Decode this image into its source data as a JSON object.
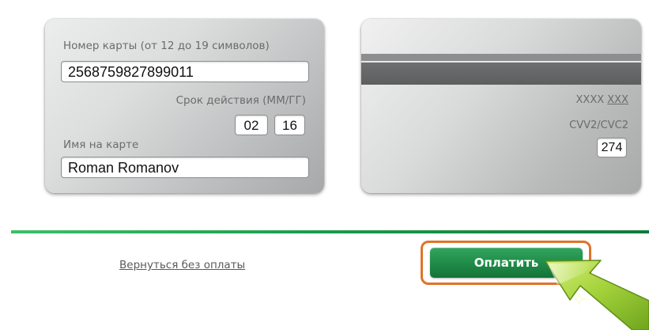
{
  "card_front": {
    "number_label": "Номер карты (от 12 до 19 символов)",
    "number_value": "2568759827899011",
    "expiry_label": "Срок действия (ММ/ГГ)",
    "expiry_month": "02",
    "expiry_year": "16",
    "name_label": "Имя на карте",
    "name_value": "Roman Romanov"
  },
  "card_back": {
    "masked_prefix": "XXXX",
    "masked_suffix": "XXX",
    "cvv_label": "CVV2/CVC2",
    "cvv_value": "274"
  },
  "footer": {
    "back_link": "Вернуться без оплаты",
    "pay_button": "Оплатить"
  },
  "colors": {
    "accent_green": "#1f8a47",
    "highlight_orange": "#e0732a",
    "pointer_arrow": "#8cc63f"
  },
  "icons": {
    "pointer": "arrow-pointer-icon"
  }
}
